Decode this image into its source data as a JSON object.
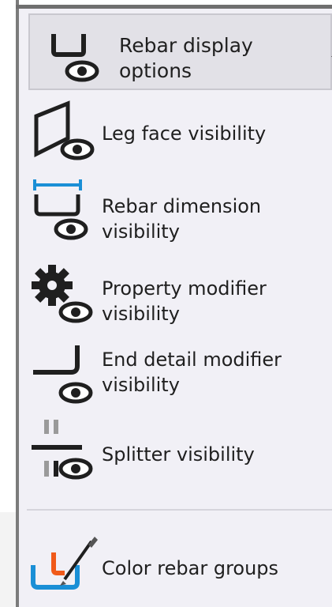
{
  "header": {
    "label": "Rebar display\noptions",
    "icon": "rebar-eye-icon"
  },
  "items": [
    {
      "label": "Leg face visibility",
      "icon": "leg-face-eye-icon"
    },
    {
      "label": "Rebar dimension\nvisibility",
      "icon": "rebar-dimension-eye-icon"
    },
    {
      "label": "Property modifier\nvisibility",
      "icon": "gear-eye-icon"
    },
    {
      "label": "End detail modifier\nvisibility",
      "icon": "end-detail-eye-icon"
    },
    {
      "label": "Splitter visibility",
      "icon": "splitter-eye-icon"
    },
    {
      "label": "Color rebar groups",
      "icon": "color-brush-icon"
    }
  ],
  "colors": {
    "menu_background": "#f1f0f6",
    "header_background": "#e2e1e7",
    "icon_dark": "#1f1f1f",
    "dimension_blue": "#1a8fd6",
    "accent_orange": "#f05a1a",
    "splitter_gray": "#9a9a9a"
  }
}
